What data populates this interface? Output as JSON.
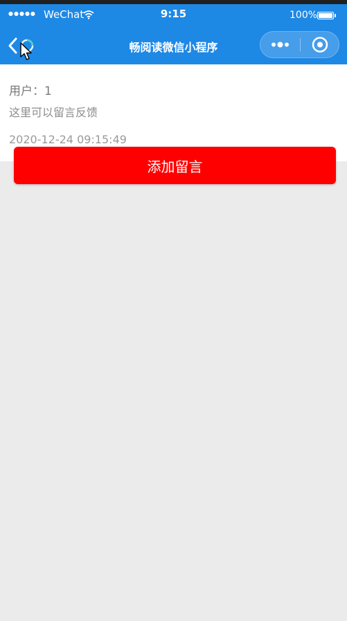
{
  "status_bar": {
    "signal_dots": "●●●●●",
    "carrier": "WeChat",
    "time": "9:15",
    "battery_percent": "100%"
  },
  "nav_bar": {
    "title": "畅阅读微信小程序"
  },
  "message_card": {
    "user": "用户：1",
    "content": "这里可以留言反馈",
    "timestamp": "2020-12-24 09:15:49"
  },
  "add_button": {
    "label": "添加留言"
  },
  "colors": {
    "header": "#1e88e5",
    "button": "#ff0000",
    "background": "#ebebeb"
  },
  "icons": {
    "wifi": "wifi-icon",
    "battery": "battery-icon",
    "back": "back-icon",
    "more": "more-icon",
    "close": "close-icon",
    "cursor": "mouse-cursor-icon"
  }
}
